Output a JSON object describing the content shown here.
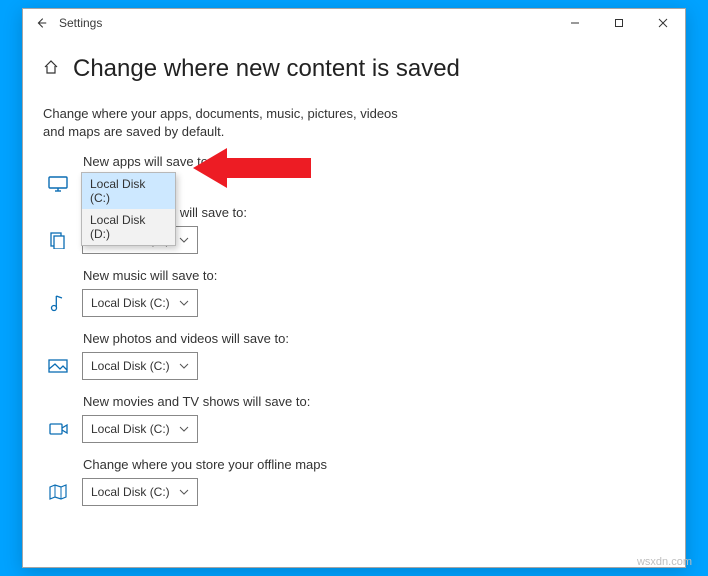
{
  "window": {
    "app_title": "Settings"
  },
  "page": {
    "title": "Change where new content is saved",
    "description": "Change where your apps, documents, music, pictures, videos and maps are saved by default."
  },
  "sections": {
    "apps": {
      "label": "New apps will save to:",
      "value": "Local Disk (C:)",
      "options": [
        "Local Disk (C:)",
        "Local Disk (D:)"
      ]
    },
    "documents": {
      "label": "New documents will save to:",
      "value": "Local Disk (C:)"
    },
    "music": {
      "label": "New music will save to:",
      "value": "Local Disk (C:)"
    },
    "photos": {
      "label": "New photos and videos will save to:",
      "value": "Local Disk (C:)"
    },
    "movies": {
      "label": "New movies and TV shows will save to:",
      "value": "Local Disk (C:)"
    },
    "maps": {
      "label": "Change where you store your offline maps",
      "value": "Local Disk (C:)"
    }
  },
  "watermark": "wsxdn.com"
}
